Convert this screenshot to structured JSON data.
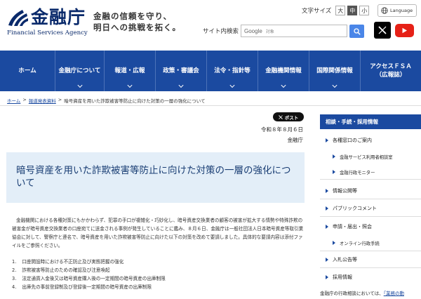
{
  "header": {
    "logo_text": "金融庁",
    "logo_sub": "Financial Services Agency",
    "tagline_line1": "金融の信頼を守り、",
    "tagline_line2": "明日への挑戦を拓く。",
    "font_size_label": "文字サイズ",
    "font_sizes": [
      "大",
      "中",
      "小"
    ],
    "active_font_size": "中",
    "language_label": "Language",
    "site_search_label": "サイト内検索",
    "search_brand": "Google",
    "search_placeholder": "対象",
    "icons": [
      "globe-icon",
      "search-icon",
      "x-icon",
      "youtube-icon"
    ]
  },
  "nav": {
    "items": [
      {
        "label": "ホーム"
      },
      {
        "label": "金融庁について"
      },
      {
        "label": "報道・広報"
      },
      {
        "label": "政策・審議会"
      },
      {
        "label": "法令・指針等"
      },
      {
        "label": "金融機関情報"
      },
      {
        "label": "国際関係情報"
      },
      {
        "label": "アクセスＦＳＡ\n（広報誌）"
      }
    ]
  },
  "breadcrumb": {
    "home": "ホーム",
    "sep": ">",
    "section": "報道発表資料",
    "current": "暗号資産を用いた詐欺被害等防止に向けた対策の一層の強化について"
  },
  "article": {
    "post_label": "ポスト",
    "date": "令和８年８月６日",
    "org": "金融庁",
    "title": "暗号資産を用いた詐欺被害等防止に向けた対策の一層の強化について",
    "body": "金融機関における各種対策にもかかわらず、犯罪の手口が複雑化・巧妙化し、暗号資産交換業者の顧客の被害が拡大する情勢や特殊詐欺の被害金が暗号資産交換業者の口座宛てに送金される事例が発生していることに鑑み、８月６日、金融庁は一般社団法人日本暗号資産等取引業協会に対して、警察庁と連名で、暗号資産を用いた詐欺被害等防止に向けた以下の対策を改めて要請しました。具体的な要請内容は添付ファイルをご参照ください。",
    "list": [
      {
        "num": "1.",
        "text": "口座開設時における不正防止及び実態把握の強化"
      },
      {
        "num": "2.",
        "text": "詐欺被害等防止のための確認及び注意喚起"
      },
      {
        "num": "3.",
        "text": "法定通貨入金後又は暗号資産購入後の一定期間の暗号資産の出庫制限"
      },
      {
        "num": "4.",
        "text": "出庫先の事前登録制及び登録後一定期間の暗号資産の出庫制限"
      }
    ]
  },
  "sidebar": {
    "heading": "相談・手続・採用情報",
    "items": [
      {
        "label": "各種窓口のご案内",
        "level": "main"
      },
      {
        "label": "金融サービス利用者相談室",
        "level": "sub"
      },
      {
        "label": "金融行政モニター",
        "level": "sub"
      },
      {
        "label": "情報公開等",
        "level": "main"
      },
      {
        "label": "パブリックコメント",
        "level": "main"
      },
      {
        "label": "申請・届出・照会",
        "level": "main"
      },
      {
        "label": "オンライン行政手続",
        "level": "sub"
      },
      {
        "label": "入札公告等",
        "level": "main"
      },
      {
        "label": "採用情報",
        "level": "main"
      }
    ],
    "footer_text": "金融庁の行政相談においては、",
    "footer_link": "「業務の動"
  },
  "colors": {
    "brand_blue": "#1b4aa0",
    "title_bg": "#e3eef8",
    "title_text": "#1a3e74"
  }
}
